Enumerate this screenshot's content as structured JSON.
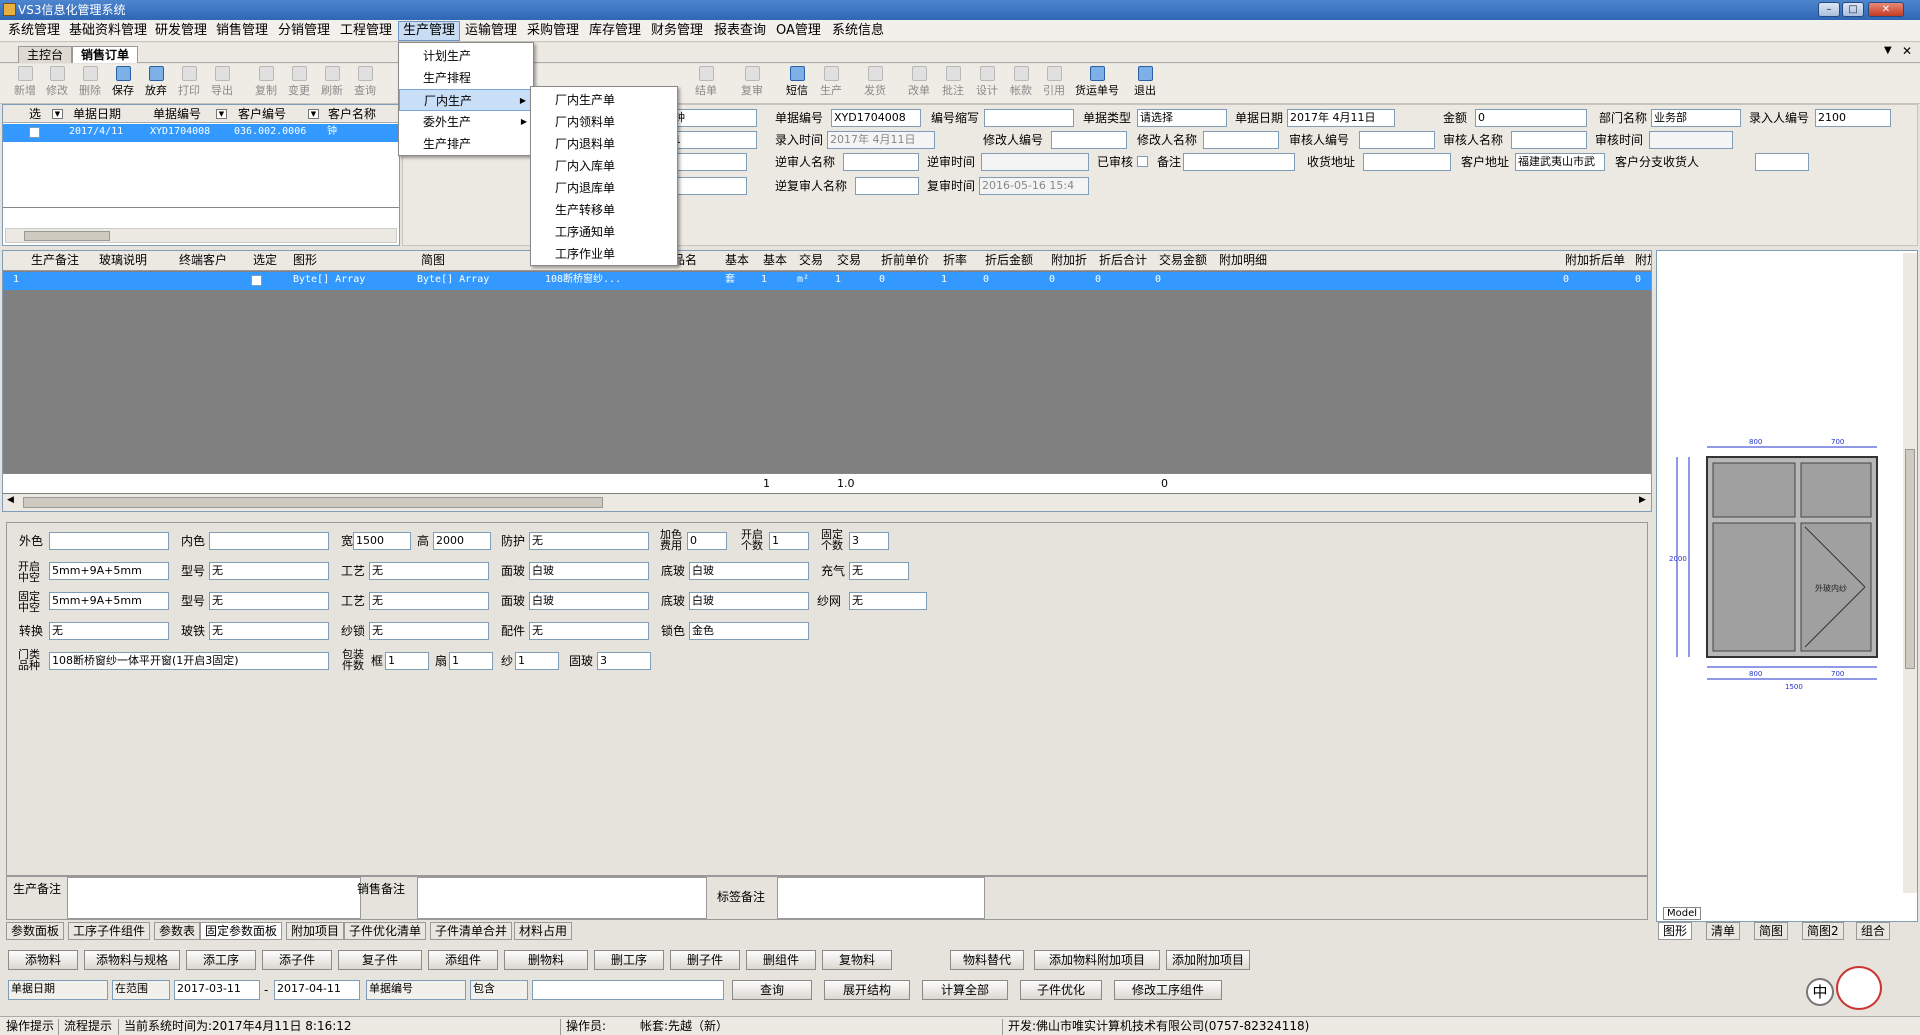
{
  "app": {
    "title": "VS3信息化管理系统"
  },
  "menu": [
    "系统管理",
    "基础资料管理",
    "研发管理",
    "销售管理",
    "分销管理",
    "工程管理",
    "生产管理",
    "运输管理",
    "采购管理",
    "库存管理",
    "财务管理",
    "报表查询",
    "OA管理",
    "系统信息"
  ],
  "tabs": [
    "主控台",
    "销售订单"
  ],
  "toolbar": [
    "新增",
    "修改",
    "删除",
    "保存",
    "放弃",
    "打印",
    "导出",
    "复制",
    "变更",
    "刷新",
    "查询",
    "结单",
    "复审",
    "短信",
    "生产",
    "发货",
    "改单",
    "批注",
    "设计",
    "帐款",
    "引用",
    "货运单号",
    "退出"
  ],
  "dropdown": {
    "main": [
      "计划生产",
      "生产排程",
      "厂内生产",
      "委外生产",
      "生产排产"
    ],
    "sub": [
      "厂内生产单",
      "厂内领料单",
      "厂内退料单",
      "厂内入库单",
      "厂内退库单",
      "生产转移单",
      "工序通知单",
      "工序作业单"
    ]
  },
  "order_grid": {
    "headers": [
      "选",
      "单据日期",
      "单据编号",
      "客户编号",
      "客户名称"
    ],
    "row": {
      "date": "2017/4/11",
      "no": "XYD1704008",
      "cust_no": "036.002.0006",
      "cust_name": "钟"
    },
    "total": "0"
  },
  "form": {
    "labels": [
      "单据编号",
      "编号缩写",
      "单据类型",
      "单据日期",
      "金额",
      "部门名称",
      "录入人编号",
      "录入时间",
      "修改人编号",
      "修改人名称",
      "审核人编号",
      "审核人名称",
      "审核时间",
      "逆审人名称",
      "逆审时间",
      "已审核",
      "备注",
      "收货地址",
      "客户地址",
      "客户分支收货人",
      "逆复审人名称",
      "复审时间"
    ],
    "values": {
      "bill_no": "XYD1704008",
      "bill_type": "请选择",
      "bill_date": "2017年 4月11日",
      "amount": "0",
      "dept": "业务部",
      "entry_no": "2100",
      "entry_time": "2017年 4月11日",
      "cust_addr": "福建武夷山市武",
      "review_time": "2016-05-16 15:4",
      "cust_name_short": "钟",
      "tel_short": "1"
    }
  },
  "detail_grid": {
    "headers": [
      "生产备注",
      "玻璃说明",
      "终端客户",
      "选定",
      "图形",
      "简图",
      "品名",
      "基本",
      "基本",
      "交易",
      "交易",
      "折前单价",
      "折率",
      "折后金额",
      "附加折",
      "折后合计",
      "交易金额",
      "附加明细",
      "附加折后单",
      "附加"
    ],
    "row": {
      "idx": "1",
      "graph": "Byte[] Array",
      "sketch": "Byte[] Array",
      "name": "108断桥窗纱...",
      "unit": "套",
      "qty": "1",
      "unit2": "m²",
      "qty2": "1",
      "price": "0",
      "rate": "1",
      "amt": "0",
      "add": "0",
      "total": "0",
      "trade": "0",
      "addafter": "0",
      "last": "0"
    },
    "footer": [
      "1",
      "1.0",
      "0"
    ]
  },
  "params": {
    "labels": [
      "外色",
      "内色",
      "宽",
      "高",
      "防护",
      "加色费用",
      "开启个数",
      "固定个数",
      "开启中空",
      "型号",
      "工艺",
      "面玻",
      "底玻",
      "充气",
      "固定中空",
      "型号",
      "工艺",
      "面玻",
      "底玻",
      "纱网",
      "转换",
      "玻铁",
      "纱锁",
      "配件",
      "锁色",
      "门类品种",
      "包装件数",
      "框",
      "扇",
      "纱",
      "固玻"
    ],
    "values": {
      "outer_color": "",
      "inner_color": "",
      "width": "1500",
      "height": "2000",
      "guard": "无",
      "add_fee": "0",
      "open_count": "1",
      "fixed_count": "3",
      "open_glass": "5mm+9A+5mm",
      "model1": "无",
      "craft1": "无",
      "face_glass1": "白玻",
      "bottom_glass1": "白玻",
      "gas": "无",
      "fixed_glass": "5mm+9A+5mm",
      "model2": "无",
      "craft2": "无",
      "face_glass2": "白玻",
      "bottom_glass2": "白玻",
      "screen": "无",
      "convert": "无",
      "glass_iron": "无",
      "screen_lock": "无",
      "parts": "无",
      "lock_color": "金色",
      "product": "108断桥窗纱一体平开窗(1开启3固定)",
      "frame": "1",
      "sash": "1",
      "yarn": "1",
      "fix_glass": "3"
    },
    "remarks": [
      "生产备注",
      "销售备注",
      "标签备注"
    ]
  },
  "bottom_tabs": [
    "参数面板",
    "工序子件组件",
    "参数表",
    "固定参数面板",
    "附加项目",
    "子件优化清单",
    "子件清单合并",
    "材料占用"
  ],
  "action_buttons": [
    "添物料",
    "添物料与规格",
    "添工序",
    "添子件",
    "复子件",
    "添组件",
    "删物料",
    "删工序",
    "删子件",
    "删组件",
    "复物料",
    "物料替代",
    "添加物料附加项目",
    "添加附加项目"
  ],
  "filter": {
    "field": "单据日期",
    "range": "在范围",
    "date_from": "2017-03-11",
    "date_to": "2017-04-11",
    "field2": "单据编号",
    "op": "包含",
    "query": "查询",
    "expand": "展开结构",
    "calc": "计算全部",
    "optimize": "子件优化",
    "modify": "修改工序组件"
  },
  "drawing": {
    "dims_top": [
      "800",
      "700"
    ],
    "dims_bottom": [
      "800",
      "700",
      "1500"
    ],
    "dim_left_total": "2000",
    "label": "外玻内纱",
    "model_tab": "Model",
    "tabs": [
      "图形",
      "清单",
      "简图",
      "简图2",
      "组合"
    ]
  },
  "status": {
    "hint": "操作提示",
    "flow": "流程提示",
    "time": "当前系统时间为:2017年4月11日 8:16:12",
    "operator": "操作员:",
    "account": "帐套:先越（新）",
    "dev": "开发:佛山市唯实计算机技术有限公司(0757-82324118)"
  },
  "ime": "中"
}
